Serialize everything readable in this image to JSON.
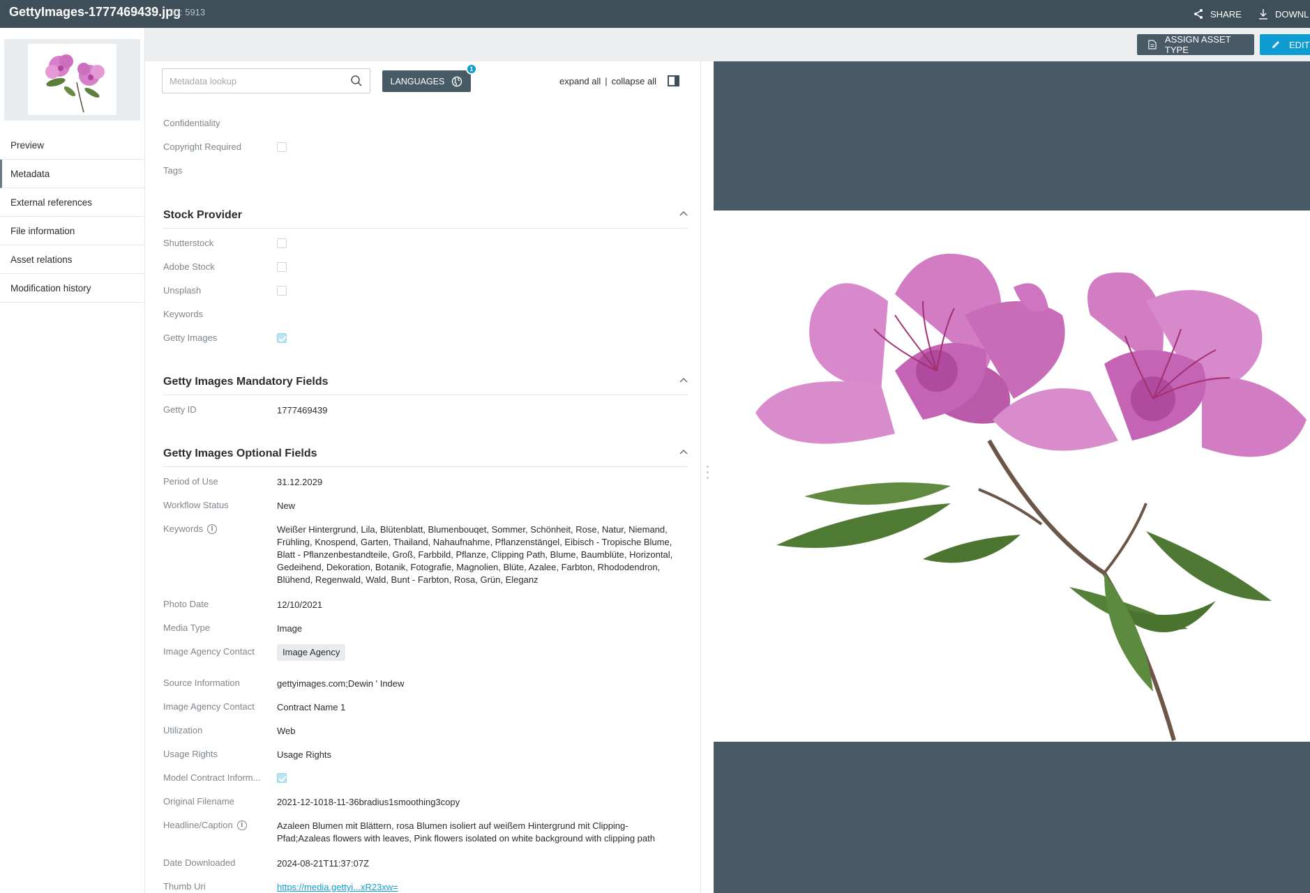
{
  "topbar": {
    "filename": "GettyImages-1777469439.jpg",
    "id_label": "ID: 5913",
    "share_label": "SHARE",
    "download_label": "DOWNL"
  },
  "actionbar": {
    "assign_label": "ASSIGN ASSET TYPE",
    "edit_label": "EDIT"
  },
  "nav": {
    "items": [
      {
        "label": "Preview"
      },
      {
        "label": "Metadata"
      },
      {
        "label": "External references"
      },
      {
        "label": "File information"
      },
      {
        "label": "Asset relations"
      },
      {
        "label": "Modification history"
      }
    ],
    "active": "Metadata"
  },
  "toolbar": {
    "search_placeholder": "Metadata lookup",
    "languages_label": "LANGUAGES",
    "languages_badge": "1",
    "expand_all": "expand all",
    "separator": "|",
    "collapse_all": "collapse all"
  },
  "general": {
    "confidentiality": "Confidentiality",
    "copyright_required": "Copyright Required",
    "tags": "Tags"
  },
  "stock_provider": {
    "title": "Stock Provider",
    "shutterstock": "Shutterstock",
    "adobe_stock": "Adobe Stock",
    "unsplash": "Unsplash",
    "keywords": "Keywords",
    "getty_images": "Getty Images",
    "getty_images_checked": true
  },
  "mandatory": {
    "title": "Getty Images Mandatory Fields",
    "getty_id_label": "Getty ID",
    "getty_id_value": "1777469439"
  },
  "optional": {
    "title": "Getty Images Optional Fields",
    "period_label": "Period of Use",
    "period_value": "31.12.2029",
    "workflow_label": "Workflow Status",
    "workflow_value": "New",
    "keywords_label": "Keywords",
    "keywords_value": "Weißer Hintergrund, Lila, Blütenblatt, Blumenbouqet, Sommer, Schönheit, Rose, Natur, Niemand, Frühling, Knospend, Garten, Thailand, Nahaufnahme, Pflanzenstängel, Eibisch - Tropische Blume, Blatt - Pflanzenbestandteile, Groß, Farbbild, Pflanze, Clipping Path, Blume, Baumblüte, Horizontal, Gedeihend, Dekoration, Botanik, Fotografie, Magnolien, Blüte, Azalee, Farbton, Rhododendron, Blühend, Regenwald, Wald, Bunt - Farbton, Rosa, Grün, Eleganz",
    "photo_date_label": "Photo Date",
    "photo_date_value": "12/10/2021",
    "media_type_label": "Media Type",
    "media_type_value": "Image",
    "agency_contact_label": "Image Agency Contact",
    "agency_chip": "Image Agency",
    "source_label": "Source Information",
    "source_value": "gettyimages.com;Dewin ' Indew",
    "agency_contact2_label": "Image Agency Contact",
    "agency_contact2_value": "Contract Name 1",
    "utilization_label": "Utilization",
    "utilization_value": "Web",
    "usage_rights_label": "Usage Rights",
    "usage_rights_value": "Usage Rights",
    "model_contract_label": "Model Contract Inform...",
    "model_contract_checked": true,
    "original_filename_label": "Original Filename",
    "original_filename_value": "2021-12-1018-11-36bradius1smoothing3copy",
    "headline_label": "Headline/Caption",
    "headline_value": "Azaleen Blumen mit Blättern, rosa Blumen isoliert auf weißem Hintergrund mit Clipping-Pfad;Azaleas flowers with leaves, Pink flowers isolated on white background with clipping path",
    "date_downloaded_label": "Date Downloaded",
    "date_downloaded_value": "2024-08-21T11:37:07Z",
    "thumb_uri_label": "Thumb Uri",
    "thumb_uri_value": "https://media.gettyi...xR23xw="
  },
  "colors": {
    "topbar": "#3f4f5a",
    "accent": "#0e9dd3",
    "button_dark": "#485a66",
    "flower_pink": "#d77fc8"
  }
}
